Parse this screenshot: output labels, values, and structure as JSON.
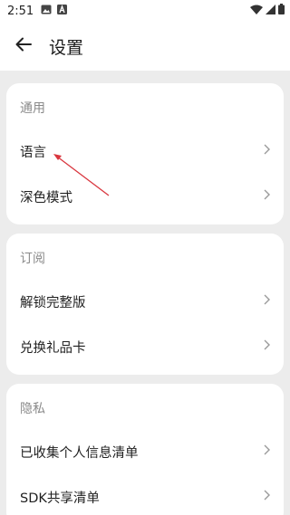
{
  "status_bar": {
    "time": "2:51",
    "icons": [
      "image-icon",
      "a-app-icon",
      "wifi-icon",
      "signal-icon",
      "battery-icon"
    ]
  },
  "app_bar": {
    "title": "设置",
    "back_icon": "arrow-left-icon"
  },
  "sections": [
    {
      "header": "通用",
      "items": [
        {
          "label": "语言"
        },
        {
          "label": "深色模式"
        }
      ]
    },
    {
      "header": "订阅",
      "items": [
        {
          "label": "解锁完整版"
        },
        {
          "label": "兑换礼品卡"
        }
      ]
    },
    {
      "header": "隐私",
      "items": [
        {
          "label": "已收集个人信息清单"
        },
        {
          "label": "SDK共享清单"
        }
      ]
    }
  ],
  "colors": {
    "background": "#ececec",
    "card": "#ffffff",
    "header_text": "#8a8a8a",
    "annotation_arrow": "#d9363e"
  }
}
